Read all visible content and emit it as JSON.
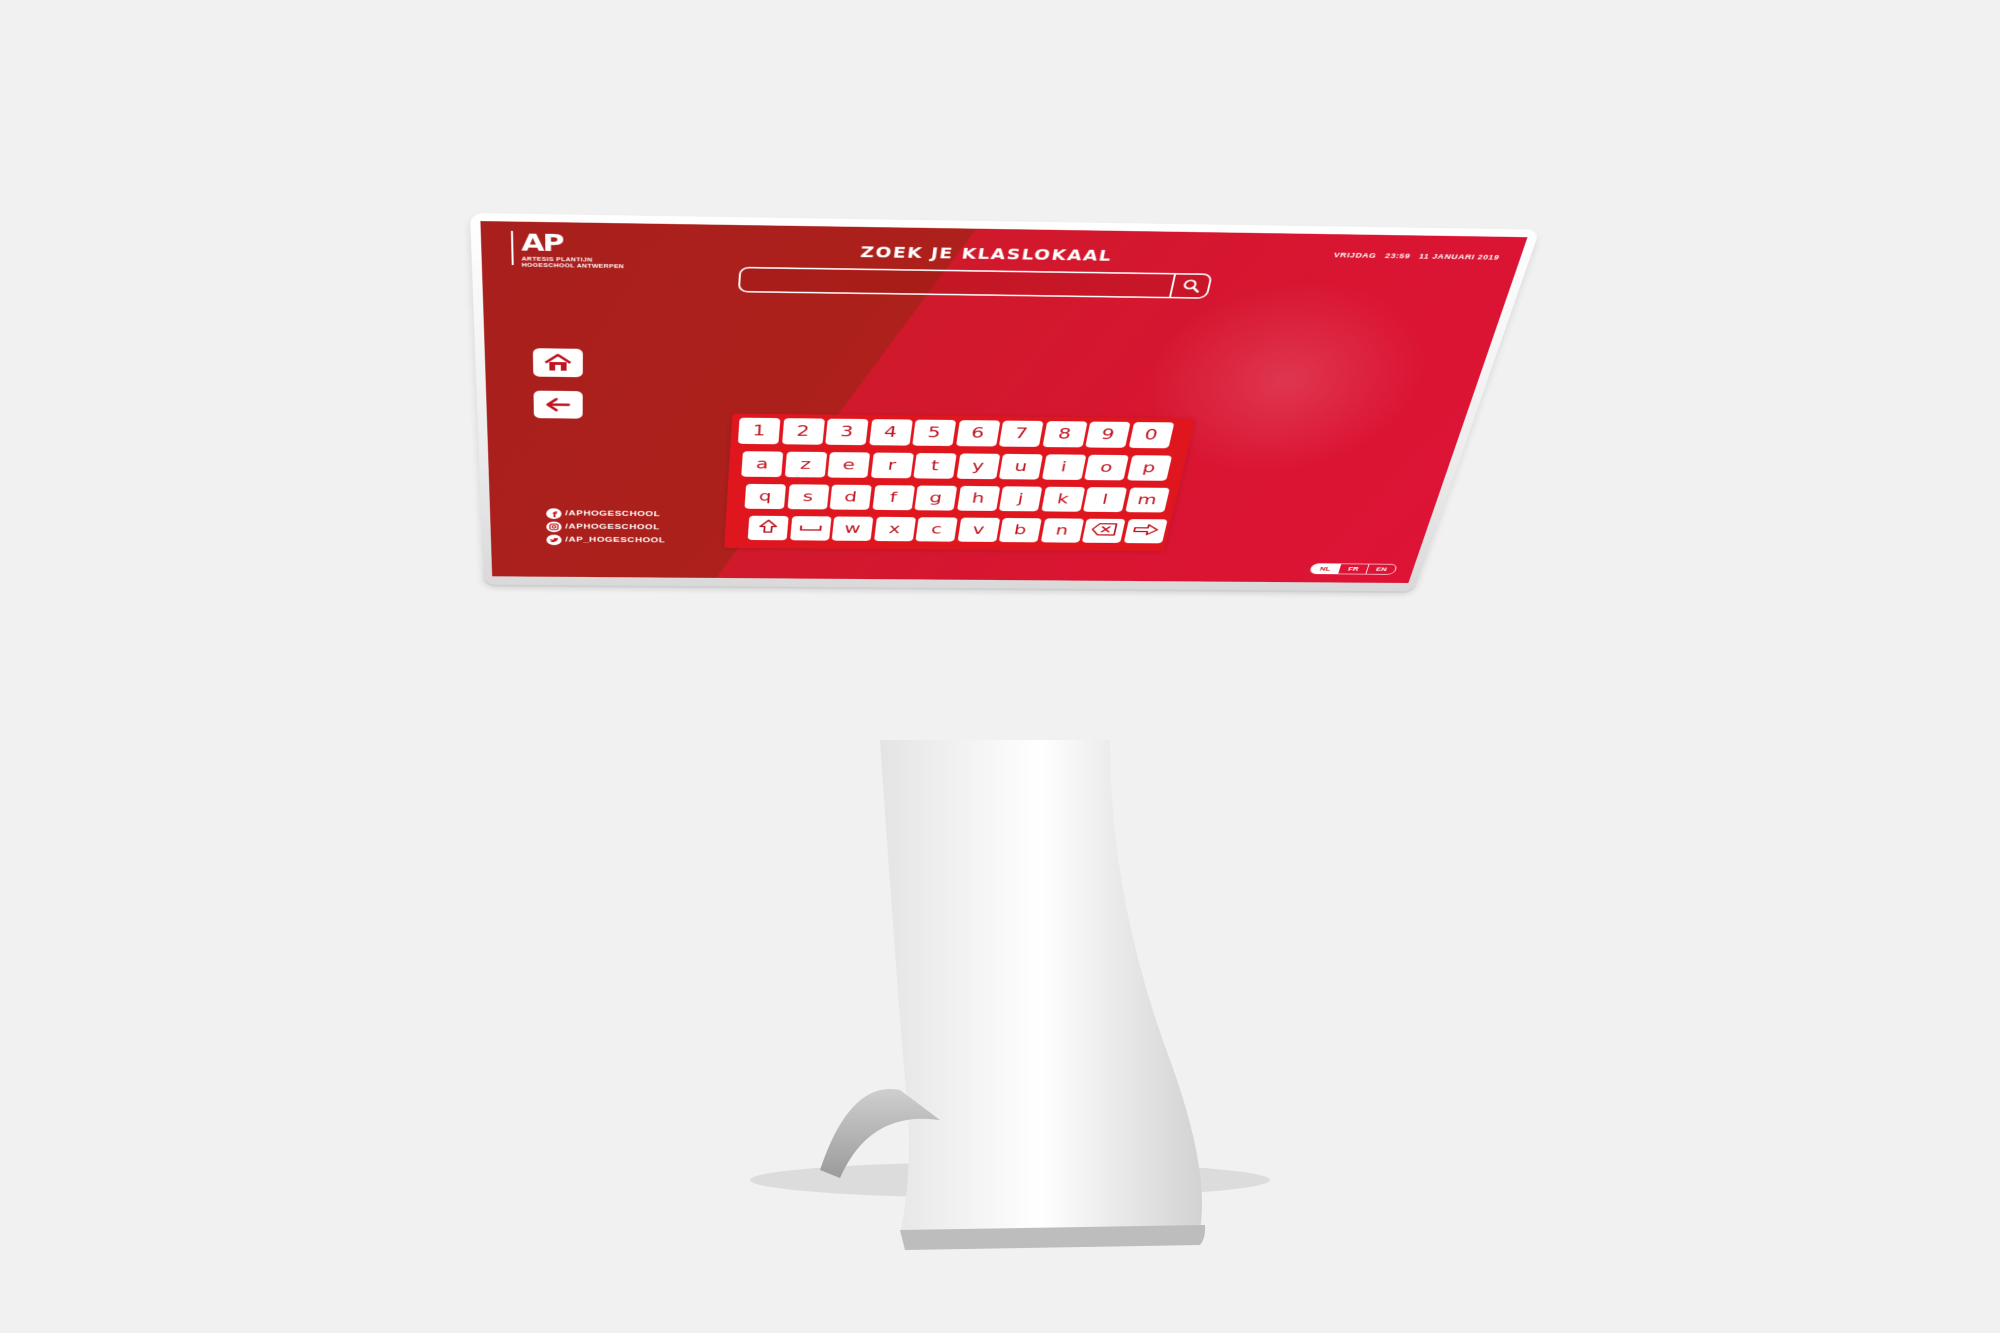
{
  "logo": {
    "mark": "AP",
    "line1": "ARTESIS PLANTIJN",
    "line2": "HOGESCHOOL ANTWERPEN"
  },
  "header": {
    "title": "ZOEK JE KLASLOKAAL",
    "day": "VRIJDAG",
    "time": "23:59",
    "date": "11 JANUARI 2019"
  },
  "search": {
    "value": "",
    "placeholder": "",
    "icon": "search-icon"
  },
  "sidebar": {
    "home_icon": "home-icon",
    "back_icon": "arrow-left-icon"
  },
  "social": [
    {
      "icon": "facebook-icon",
      "handle": "/APHOGESCHOOL"
    },
    {
      "icon": "instagram-icon",
      "handle": "/APHOGESCHOOL"
    },
    {
      "icon": "twitter-icon",
      "handle": "/AP_HOGESCHOOL"
    }
  ],
  "keyboard": {
    "rows": [
      [
        "1",
        "2",
        "3",
        "4",
        "5",
        "6",
        "7",
        "8",
        "9",
        "0"
      ],
      [
        "a",
        "z",
        "e",
        "r",
        "t",
        "y",
        "u",
        "i",
        "o",
        "p"
      ],
      [
        "q",
        "s",
        "d",
        "f",
        "g",
        "h",
        "j",
        "k",
        "l",
        "m"
      ],
      [
        "shift-icon",
        "space-icon",
        "w",
        "x",
        "c",
        "v",
        "b",
        "n",
        "backspace-icon",
        "enter-arrow-icon"
      ]
    ]
  },
  "languages": [
    {
      "code": "NL",
      "active": true
    },
    {
      "code": "FR",
      "active": false
    },
    {
      "code": "EN",
      "active": false
    }
  ],
  "colors": {
    "primary_red": "#d91532",
    "dark_red": "#a81f1d",
    "key_text": "#c0141f",
    "frame_white": "#f5f5f5",
    "background": "#f1f1f1"
  }
}
